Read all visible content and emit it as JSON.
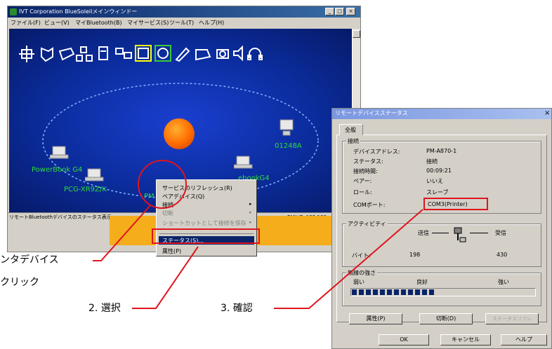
{
  "main_window": {
    "title": "IVT Corporation BlueSoleilメインウィンドー",
    "menu": [
      "ファイル(F)",
      "ビュー(V)",
      "マイBluetooth(B)",
      "マイサービス(S)",
      "ツール(T)",
      "ヘルプ(H)"
    ],
    "devices": [
      "PowerBook G4",
      "PCG-XR9Z/K",
      "PM",
      "ebookG4",
      "01248A"
    ],
    "status_left": "リモートBluetoothデバイスのステータス表示",
    "status_right": "PAN IP: 192.168",
    "window_buttons": [
      "_",
      "□",
      "×"
    ]
  },
  "context_menu": {
    "items": [
      "サービスのリフレッシュ(R)",
      "ペアデバイス(Q)",
      "接続",
      "切断",
      "ショートカットとして接続を保存",
      "ステータス(S)...",
      "属性(P)"
    ]
  },
  "dialog": {
    "title": "リモートデバイスステータス",
    "close": "×",
    "tab": "全般",
    "connection": {
      "group_label": "接続",
      "rows": [
        {
          "label": "デバイスアドレス:",
          "value": "PM-A870-1"
        },
        {
          "label": "ステータス:",
          "value": "接続"
        },
        {
          "label": "接続時間:",
          "value": "00:09:21"
        },
        {
          "label": "ペアー:",
          "value": "いいえ"
        },
        {
          "label": "ロール:",
          "value": "スレーブ"
        },
        {
          "label": "COMポート:",
          "value": "COM3(Printer)"
        }
      ]
    },
    "activity": {
      "group_label": "アクティビティ",
      "sent_label": "送信",
      "received_label": "受信",
      "bytes_label": "バイト:",
      "sent_bytes": "198",
      "received_bytes": "430"
    },
    "signal": {
      "group_label": "無線の強さ",
      "weak": "弱い",
      "good": "良好",
      "strong": "強い",
      "level": 0.45
    },
    "buttons": {
      "attributes": "属性(P)",
      "disconnect": "切断(D)",
      "disabled": "ステータスリフレ",
      "ok": "OK",
      "cancel": "キャンセル",
      "help": "ヘルプ"
    }
  },
  "annotations": {
    "step1_line1": "ンタデバイス",
    "step1_line2": "クリック",
    "step2": "2.  選択",
    "step3": "3.  確認"
  },
  "colors": {
    "accent_red": "#e0141e",
    "title_blue": "#0a246a",
    "canvas_blue": "#0b2c9c",
    "device_label_green": "#2fdc3a",
    "orange": "#f5ad1b"
  }
}
